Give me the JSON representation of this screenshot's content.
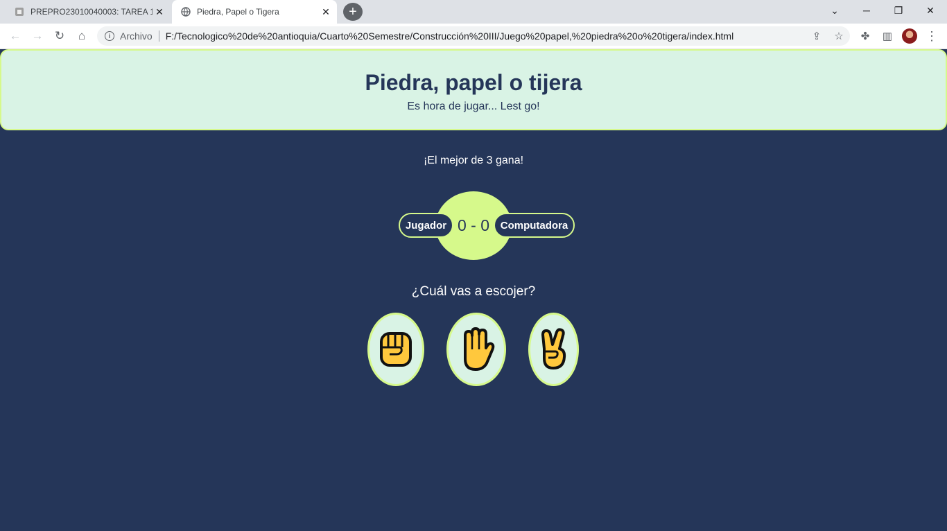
{
  "browser": {
    "tabs": [
      {
        "title": "PREPRO23010040003: TAREA 1",
        "active": false
      },
      {
        "title": "Piedra, Papel o Tigera",
        "active": true
      }
    ],
    "address": {
      "scheme_label": "Archivo",
      "url": "F:/Tecnologico%20de%20antioquia/Cuarto%20Semestre/Construcción%20III/Juego%20papel,%20piedra%20o%20tigera/index.html"
    },
    "icons": {
      "new_tab": "+",
      "close": "✕",
      "back": "←",
      "forward": "→",
      "reload": "↻",
      "home": "⌂",
      "share": "⇪",
      "star": "☆",
      "extensions": "✤",
      "side_panel": "▥",
      "menu": "⋮",
      "tab_search": "⌄",
      "minimize": "─",
      "restore": "❐",
      "window_close": "✕"
    }
  },
  "header": {
    "title": "Piedra, papel o tijera",
    "subtitle": "Es hora de jugar... Lest go!"
  },
  "game": {
    "best_of_text": "¡El mejor de 3 gana!",
    "player_label": "Jugador",
    "computer_label": "Computadora",
    "score": "0 - 0",
    "question": "¿Cuál vas a escojer?",
    "choices": [
      {
        "name": "piedra",
        "icon": "raised-fist"
      },
      {
        "name": "papel",
        "icon": "raised-hand"
      },
      {
        "name": "tijera",
        "icon": "victory-hand"
      }
    ]
  },
  "colors": {
    "background": "#253659",
    "accent": "#d6f98b",
    "panel": "#d9f3e5",
    "emoji_skin": "#ffc83d"
  }
}
